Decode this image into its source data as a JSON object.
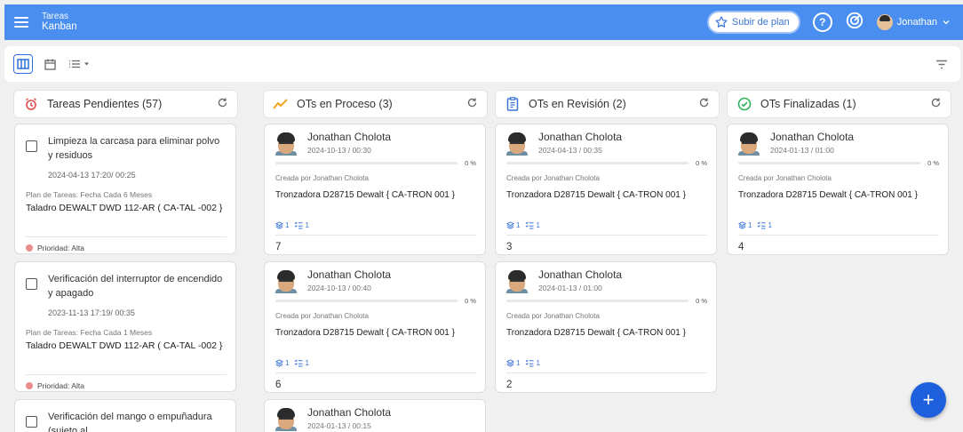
{
  "header": {
    "module": "Tareas",
    "view": "Kanban",
    "upgrade_label": "Subir de plan",
    "user_name": "Jonathan",
    "accent": "#4a8ff0"
  },
  "columns": [
    {
      "title": "Tareas Pendientes (57)",
      "color": "#e24b4b"
    },
    {
      "title": "OTs en Proceso (3)",
      "color": "#f2a31b"
    },
    {
      "title": "OTs en Revisión (2)",
      "color": "#3b74d8"
    },
    {
      "title": "OTs Finalizadas (1)",
      "color": "#2cb35a"
    }
  ],
  "tasks": [
    {
      "title": "Limpieza la carcasa para eliminar polvo y residuos",
      "date": "2024-04-13 17:20/ 00:25",
      "plan": "Plan de Tareas: Fecha Cada 6 Meses",
      "asset": "Taladro DEWALT DWD 112-AR ( CA-TAL -002 }",
      "priority": "Prioridad: Alta"
    },
    {
      "title": "Verificación del interruptor de encendido y apagado",
      "date": "2023-11-13 17:19/ 00:35",
      "plan": "Plan de Tareas: Fecha Cada 1 Meses",
      "asset": "Taladro DEWALT DWD 112-AR ( CA-TAL -002 }",
      "priority": "Prioridad: Alta"
    },
    {
      "title": "Verificación del mango o empuñadura (sujeto al"
    }
  ],
  "proceso": [
    {
      "name": "Jonathan Cholota",
      "date": "2024-10-13 / 00:30",
      "progress": "0 %",
      "created": "Creada por Jonathan Cholota",
      "asset": "Tronzadora D28715 Dewalt { CA-TRON 001 }",
      "c1": "1",
      "c2": "1",
      "number": "7"
    },
    {
      "name": "Jonathan Cholota",
      "date": "2024-10-13 / 00:40",
      "progress": "0 %",
      "created": "Creada por Jonathan Cholota",
      "asset": "Tronzadora D28715 Dewalt { CA-TRON 001 }",
      "c1": "1",
      "c2": "1",
      "number": "6"
    },
    {
      "name": "Jonathan Cholota",
      "date": "2024-01-13 / 00:15"
    }
  ],
  "revision": [
    {
      "name": "Jonathan Cholota",
      "date": "2024-04-13 / 00:35",
      "progress": "0 %",
      "created": "Creada por Jonathan Cholota",
      "asset": "Tronzadora D28715 Dewalt { CA-TRON 001 }",
      "c1": "1",
      "c2": "1",
      "number": "3"
    },
    {
      "name": "Jonathan Cholota",
      "date": "2024-01-13 / 01:00",
      "progress": "0 %",
      "created": "Creada por Jonathan Cholota",
      "asset": "Tronzadora D28715 Dewalt { CA-TRON 001 }",
      "c1": "1",
      "c2": "1",
      "number": "2"
    }
  ],
  "finalizadas": [
    {
      "name": "Jonathan Cholota",
      "date": "2024-01-13 / 01:00",
      "progress": "0 %",
      "created": "Creada por Jonathan Cholota",
      "asset": "Tronzadora D28715 Dewalt { CA-TRON 001 }",
      "c1": "1",
      "c2": "1",
      "number": "4"
    }
  ],
  "icons": {
    "menu": "hamburger-icon",
    "upgrade": "star-icon",
    "help": "help-icon",
    "target": "target-icon",
    "chevron": "chevron-down-icon",
    "board": "kanban-icon",
    "calendar": "calendar-icon",
    "list": "list-icon",
    "filter": "filter-icon",
    "refresh": "refresh-icon",
    "add": "plus-icon"
  }
}
